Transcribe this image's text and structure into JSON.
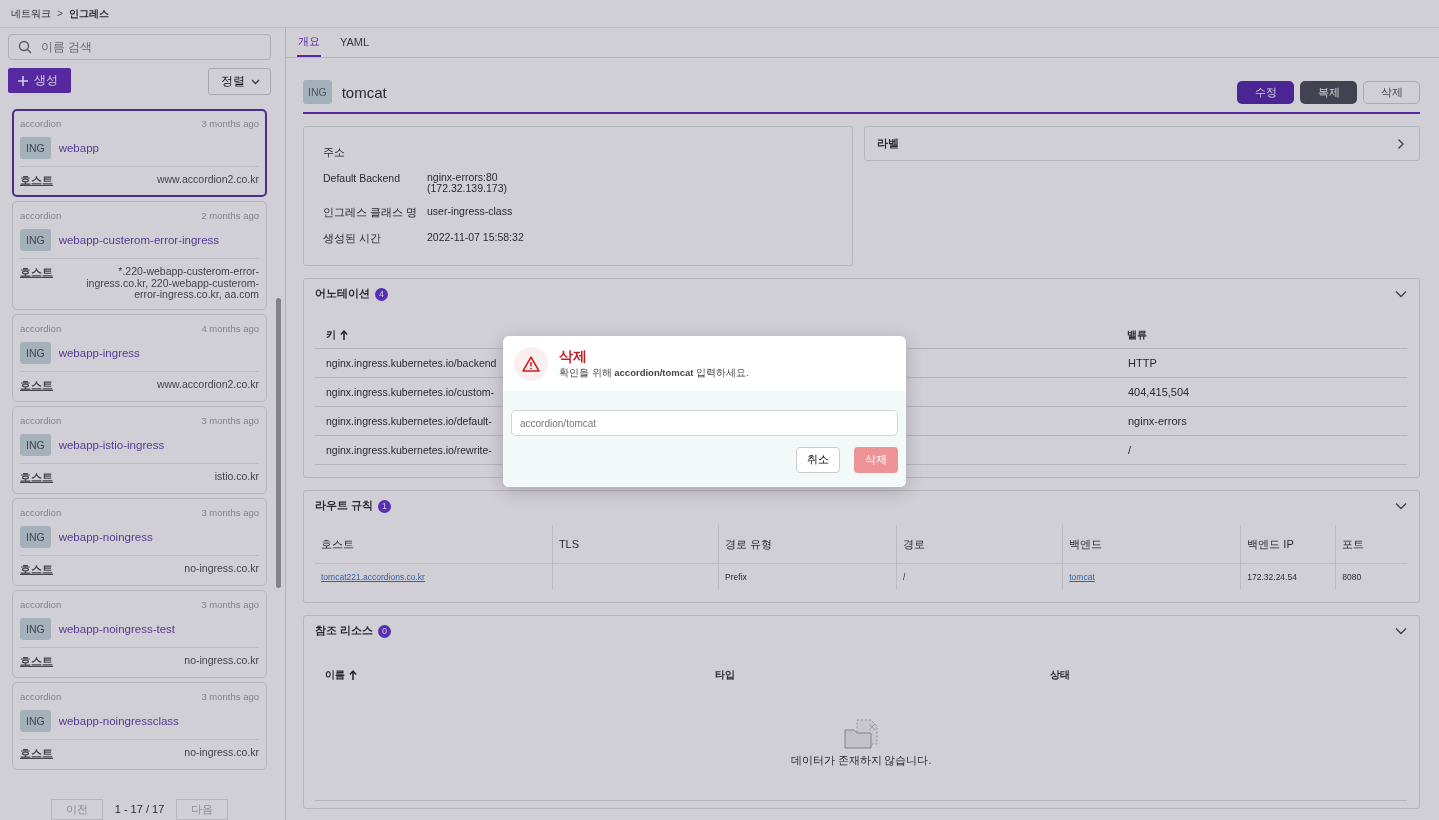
{
  "breadcrumb": {
    "parent": "네트워크",
    "separator": ">",
    "current": "인그레스"
  },
  "sidebar": {
    "search": {
      "placeholder": "이름 검색"
    },
    "create_button": "생성",
    "sort_button": "정렬",
    "items": [
      {
        "namespace": "accordion",
        "age": "3 months ago",
        "badge": "ING",
        "name": "webapp",
        "host_label": "호스트",
        "host": "www.accordion2.co.kr",
        "selected": true
      },
      {
        "namespace": "accordion",
        "age": "2 months ago",
        "badge": "ING",
        "name": "webapp-custerom-error-ingress",
        "host_label": "호스트",
        "host": "*.220-webapp-custerom-error-ingress.co.kr, 220-webapp-custerom-error-ingress.co.kr, aa.com",
        "selected": false
      },
      {
        "namespace": "accordion",
        "age": "4 months ago",
        "badge": "ING",
        "name": "webapp-ingress",
        "host_label": "호스트",
        "host": "www.accordion2.co.kr",
        "selected": false
      },
      {
        "namespace": "accordion",
        "age": "3 months ago",
        "badge": "ING",
        "name": "webapp-istio-ingress",
        "host_label": "호스트",
        "host": "istio.co.kr",
        "selected": false
      },
      {
        "namespace": "accordion",
        "age": "3 months ago",
        "badge": "ING",
        "name": "webapp-noingress",
        "host_label": "호스트",
        "host": "no-ingress.co.kr",
        "selected": false
      },
      {
        "namespace": "accordion",
        "age": "3 months ago",
        "badge": "ING",
        "name": "webapp-noingress-test",
        "host_label": "호스트",
        "host": "no-ingress.co.kr",
        "selected": false
      },
      {
        "namespace": "accordion",
        "age": "3 months ago",
        "badge": "ING",
        "name": "webapp-noingressclass",
        "host_label": "호스트",
        "host": "no-ingress.co.kr",
        "selected": false
      }
    ],
    "pagination": {
      "prev": "이전",
      "range": "1 - 17 / 17",
      "next": "다음"
    }
  },
  "tabs": [
    {
      "label": "개요",
      "selected": true
    },
    {
      "label": "YAML",
      "selected": false
    }
  ],
  "header": {
    "badge": "ING",
    "title": "tomcat",
    "buttons": [
      {
        "label": "수정",
        "kind": "primary"
      },
      {
        "label": "복제",
        "kind": "dark"
      },
      {
        "label": "삭제",
        "kind": "outline"
      }
    ]
  },
  "info": {
    "title": "주소",
    "fields": [
      {
        "label": "Default Backend",
        "value": "nginx-errors:80\n(172.32.139.173)"
      },
      {
        "label": "인그레스 클래스 명",
        "value": "user-ingress-class"
      },
      {
        "label": "생성된 시간",
        "value": "2022-11-07 15:58:32"
      }
    ]
  },
  "labels_panel": {
    "title": "라벨",
    "expanded": false
  },
  "annotations": {
    "title": "어노테이션",
    "count": "4",
    "expanded": true,
    "columns": [
      {
        "label": "키",
        "sorted": true
      },
      {
        "label": "밸류",
        "sorted": false
      }
    ],
    "rows": [
      [
        "nginx.ingress.kubernetes.io/backend",
        "HTTP"
      ],
      [
        "nginx.ingress.kubernetes.io/custom-",
        "404,415,504"
      ],
      [
        "nginx.ingress.kubernetes.io/default-",
        "nginx-errors"
      ],
      [
        "nginx.ingress.kubernetes.io/rewrite-",
        "/"
      ]
    ]
  },
  "route_rules": {
    "title": "라우트 규칙",
    "count": "1",
    "expanded": true,
    "columns": [
      "호스트",
      "TLS",
      "경로 유형",
      "경로",
      "백엔드",
      "백엔드 IP",
      "포트"
    ],
    "rows": [
      [
        {
          "text": "tomcat221.accordions.co.kr",
          "kind": "link"
        },
        {
          "kind": "empty"
        },
        {
          "text": "Prefix",
          "kind": "text"
        },
        {
          "text": "/",
          "kind": "text"
        },
        {
          "text": "tomcat",
          "kind": "link"
        },
        {
          "text": "172.32.24.54",
          "kind": "text"
        },
        {
          "text": "8080",
          "kind": "text"
        }
      ]
    ]
  },
  "references": {
    "title": "참조 리소스",
    "count": "0",
    "expanded": true,
    "columns": [
      {
        "label": "이름",
        "sorted": true
      },
      {
        "label": "타입",
        "sorted": false
      },
      {
        "label": "상태",
        "sorted": false
      }
    ],
    "empty_text": "데이터가 존재하지 않습니다."
  },
  "dialog": {
    "title": "삭제",
    "message": "확인을 위해 **accordion/tomcat** 입력하세요.",
    "input_placeholder": "accordion/tomcat",
    "cancel": "취소",
    "confirm": "삭제",
    "confirm_disabled": true
  }
}
